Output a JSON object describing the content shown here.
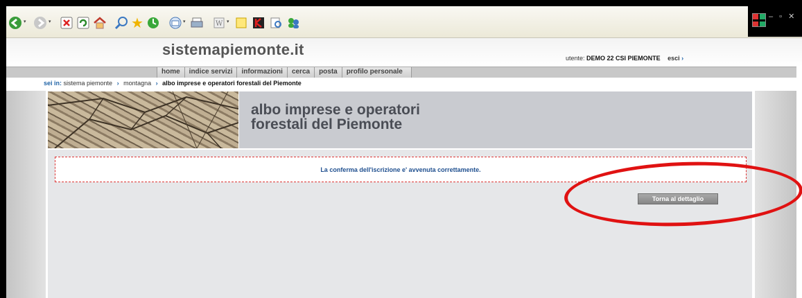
{
  "browser": {
    "toolbar_icons": [
      "back-icon",
      "forward-icon",
      "stop-icon",
      "refresh-icon",
      "home-icon",
      "search-icon",
      "favorites-icon",
      "history-icon",
      "mail-icon",
      "print-icon",
      "edit-icon",
      "note-icon",
      "kaspersky-icon",
      "research-icon",
      "messenger-icon"
    ]
  },
  "site": {
    "logo": "sistemapiemonte.it",
    "user_label": "utente:",
    "user_name": "DEMO 22 CSI PIEMONTE",
    "logout": "esci",
    "logout_arrow": "›"
  },
  "nav": {
    "items": [
      "home",
      "indice servizi",
      "informazioni",
      "cerca",
      "posta",
      "profilo personale"
    ]
  },
  "breadcrumb": {
    "label": "sei in:",
    "items": [
      "sistema piemonte",
      "montagna",
      "albo imprese e operatori forestali del Piemonte"
    ],
    "sep": "›"
  },
  "banner": {
    "title_line1": "albo imprese e operatori",
    "title_line2": "forestali del Piemonte"
  },
  "content": {
    "message": "La conferma dell'iscrizione e' avvenuta correttamente.",
    "back_button": "Torna al dettaglio"
  },
  "colors": {
    "accent": "#1f63a6",
    "annotation": "#e01212"
  }
}
